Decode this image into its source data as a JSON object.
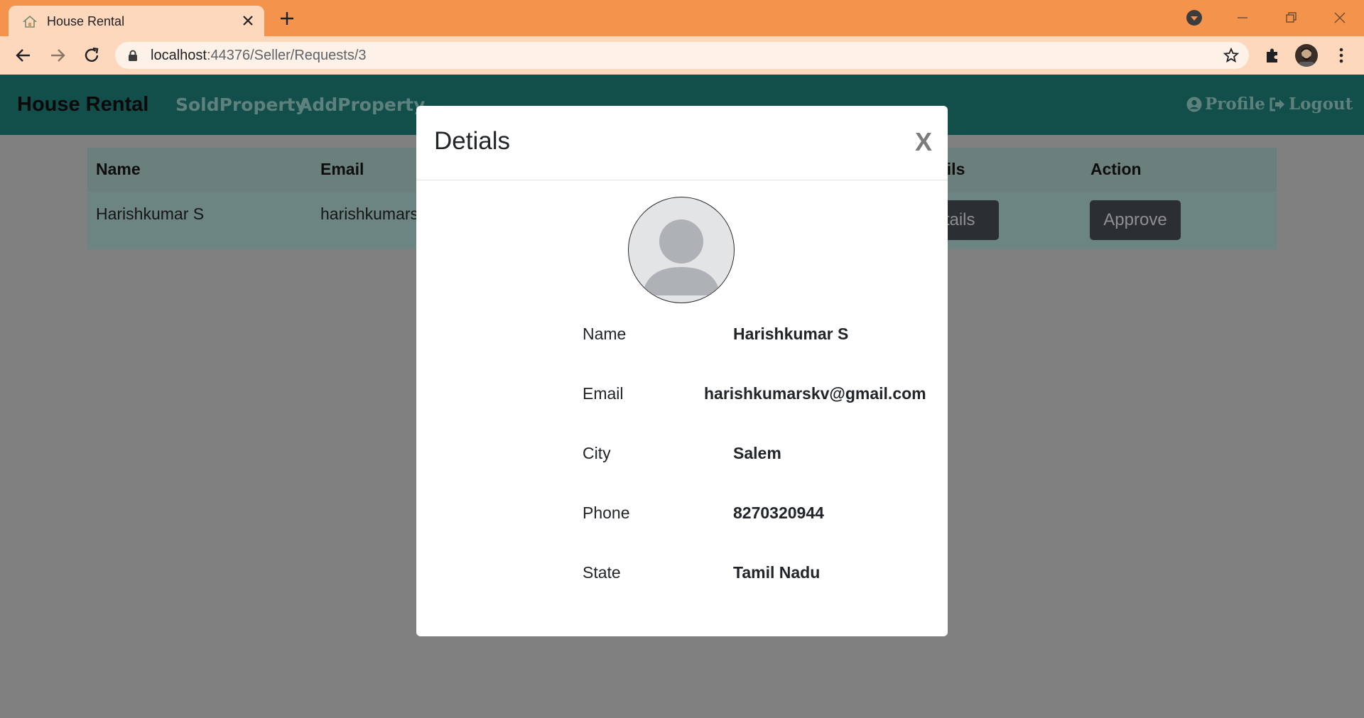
{
  "browser": {
    "tab_title": "House Rental",
    "url_host": "localhost",
    "url_rest": ":44376/Seller/Requests/3"
  },
  "navbar": {
    "brand": "House Rental",
    "links": [
      "SoldProperty",
      "AddProperty"
    ],
    "profile": "Profile",
    "logout": "Logout"
  },
  "table": {
    "headers": {
      "name": "Name",
      "email": "Email",
      "details": "ails",
      "action": "Action"
    },
    "row": {
      "name": "Harishkumar S",
      "email": "harishkumars",
      "details_button": "etails",
      "approve_button": "Approve"
    }
  },
  "modal": {
    "title": "Detials",
    "close": "X",
    "fields": [
      {
        "label": "Name",
        "value": "Harishkumar S"
      },
      {
        "label": "Email",
        "value": "harishkumarskv@gmail.com"
      },
      {
        "label": "City",
        "value": "Salem"
      },
      {
        "label": "Phone",
        "value": "8270320944"
      },
      {
        "label": "State",
        "value": "Tamil Nadu"
      }
    ]
  }
}
